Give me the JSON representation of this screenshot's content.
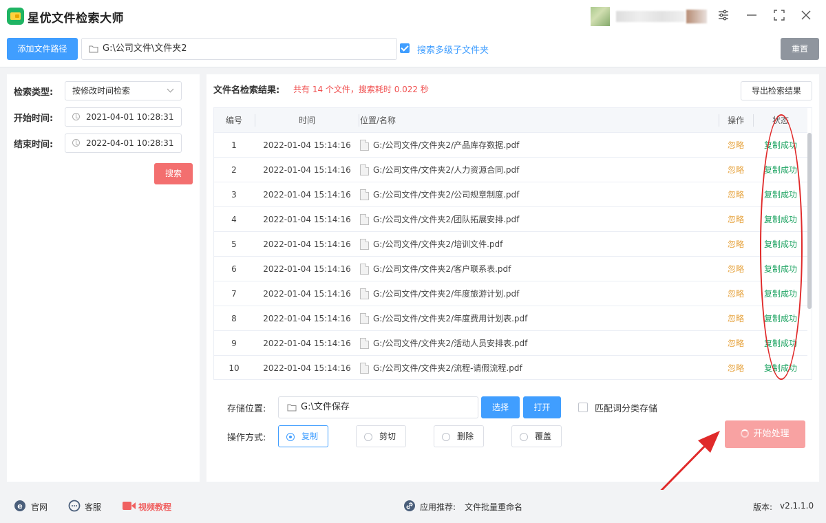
{
  "app": {
    "title": "星优文件检索大师"
  },
  "toolbar": {
    "add_path_label": "添加文件路径",
    "path_value": "G:\\公司文件\\文件夹2",
    "subfolder_label": "搜索多级子文件夹",
    "subfolder_checked": true,
    "reset_label": "重置"
  },
  "left": {
    "search_type_label": "检索类型:",
    "search_type_value": "按修改时间检索",
    "start_label": "开始时间:",
    "start_value": "2021-04-01 10:28:31",
    "end_label": "结束时间:",
    "end_value": "2022-04-01 10:28:31",
    "search_button": "搜索"
  },
  "results": {
    "title": "文件名检索结果:",
    "summary": "共有 14 个文件，搜索耗时 0.022 秒",
    "export_label": "导出检索结果",
    "columns": [
      "编号",
      "时间",
      "位置/名称",
      "操作",
      "状态"
    ],
    "rows": [
      {
        "num": "1",
        "time": "2022-01-04 15:14:16",
        "path": "G:/公司文件/文件夹2/产品库存数据.pdf",
        "op": "忽略",
        "status": "复制成功"
      },
      {
        "num": "2",
        "time": "2022-01-04 15:14:16",
        "path": "G:/公司文件/文件夹2/人力资源合同.pdf",
        "op": "忽略",
        "status": "复制成功"
      },
      {
        "num": "3",
        "time": "2022-01-04 15:14:16",
        "path": "G:/公司文件/文件夹2/公司规章制度.pdf",
        "op": "忽略",
        "status": "复制成功"
      },
      {
        "num": "4",
        "time": "2022-01-04 15:14:16",
        "path": "G:/公司文件/文件夹2/团队拓展安排.pdf",
        "op": "忽略",
        "status": "复制成功"
      },
      {
        "num": "5",
        "time": "2022-01-04 15:14:16",
        "path": "G:/公司文件/文件夹2/培训文件.pdf",
        "op": "忽略",
        "status": "复制成功"
      },
      {
        "num": "6",
        "time": "2022-01-04 15:14:16",
        "path": "G:/公司文件/文件夹2/客户联系表.pdf",
        "op": "忽略",
        "status": "复制成功"
      },
      {
        "num": "7",
        "time": "2022-01-04 15:14:16",
        "path": "G:/公司文件/文件夹2/年度旅游计划.pdf",
        "op": "忽略",
        "status": "复制成功"
      },
      {
        "num": "8",
        "time": "2022-01-04 15:14:16",
        "path": "G:/公司文件/文件夹2/年度费用计划表.pdf",
        "op": "忽略",
        "status": "复制成功"
      },
      {
        "num": "9",
        "time": "2022-01-04 15:14:16",
        "path": "G:/公司文件/文件夹2/活动人员安排表.pdf",
        "op": "忽略",
        "status": "复制成功"
      },
      {
        "num": "10",
        "time": "2022-01-04 15:14:16",
        "path": "G:/公司文件/文件夹2/流程-请假流程.pdf",
        "op": "忽略",
        "status": "复制成功"
      }
    ]
  },
  "storage": {
    "label": "存储位置:",
    "value": "G:\\文件保存",
    "select_label": "选择",
    "open_label": "打开",
    "match_label": "匹配词分类存储",
    "op_label": "操作方式:",
    "options": [
      "复制",
      "剪切",
      "删除",
      "覆盖"
    ],
    "selected": "复制",
    "start_label": "开始处理"
  },
  "footer": {
    "website": "官网",
    "support": "客服",
    "video": "视频教程",
    "recommend_label": "应用推荐:",
    "recommend_app": "文件批量重命名",
    "version_label": "版本:",
    "version": "v2.1.1.0"
  },
  "colors": {
    "primary": "#409eff",
    "danger": "#f36f6f",
    "success": "#1fa463",
    "warning": "#e6a23c",
    "annotation": "#e02a2a"
  }
}
